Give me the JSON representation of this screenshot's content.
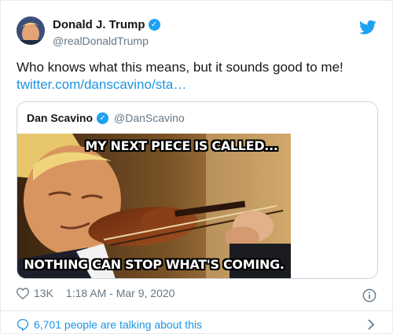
{
  "tweet": {
    "author_name": "Donald J. Trump",
    "author_handle": "@realDonaldTrump",
    "text": "Who knows what this means, but it sounds good to me!",
    "link": "twitter.com/danscavino/sta…",
    "likes": "13K",
    "timestamp": "1:18 AM - Mar 9, 2020",
    "talking": "6,701 people are talking about this"
  },
  "quoted": {
    "author_name": "Dan Scavino",
    "author_handle": "@DanScavino",
    "image_top_text": "MY NEXT PIECE IS CALLED...",
    "image_bottom_text": "NOTHING CAN STOP WHAT'S COMING."
  },
  "icons": {
    "verified": "verified-badge-icon",
    "brand": "twitter-bird-icon",
    "like": "heart-icon",
    "info": "info-icon",
    "talk": "comment-icon",
    "chevron": "chevron-right-icon"
  },
  "colors": {
    "link": "#1b95e0",
    "verified": "#1da1f2",
    "muted": "#657786",
    "border": "#ccd6dd"
  }
}
